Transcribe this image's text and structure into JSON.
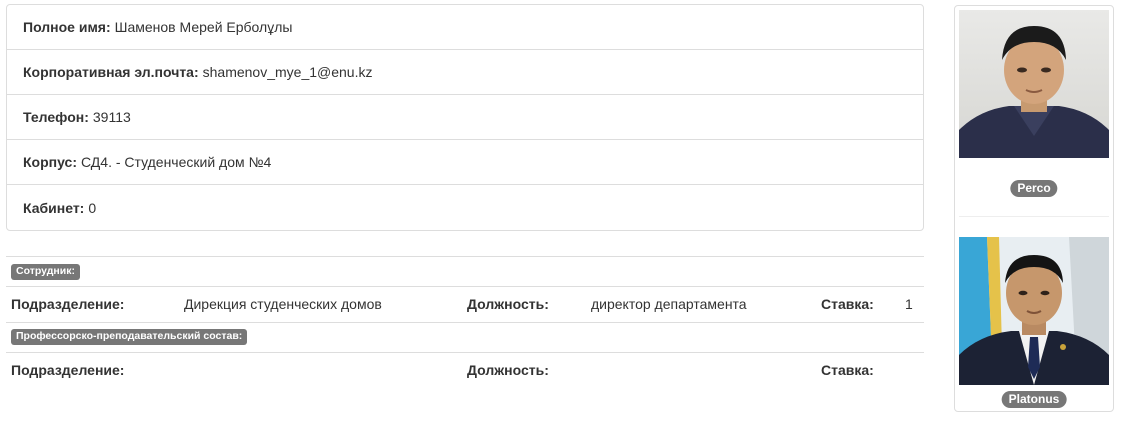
{
  "profile": {
    "full_name_label": "Полное имя:",
    "full_name": "Шаменов Мерей Ерболұлы",
    "email_label": "Корпоративная эл.почта:",
    "email": "shamenov_mye_1@enu.kz",
    "phone_label": "Телефон:",
    "phone": "39113",
    "building_label": "Корпус:",
    "building": "СД4. - Студенческий дом №4",
    "office_label": "Кабинет:",
    "office": "0"
  },
  "employee": {
    "badge": "Сотрудник:",
    "department_label": "Подразделение:",
    "department": "Дирекция студенческих домов",
    "position_label": "Должность:",
    "position": "директор департамента",
    "rate_label": "Ставка:",
    "rate": "1"
  },
  "faculty": {
    "badge": "Профессорско-преподавательский состав:",
    "department_label": "Подразделение:",
    "department": "",
    "position_label": "Должность:",
    "position": "",
    "rate_label": "Ставка:",
    "rate": ""
  },
  "photos": [
    {
      "source": "Perco"
    },
    {
      "source": "Platonus"
    }
  ],
  "colors": {
    "badge_bg": "#777777",
    "border": "#dddddd",
    "text": "#333333"
  }
}
